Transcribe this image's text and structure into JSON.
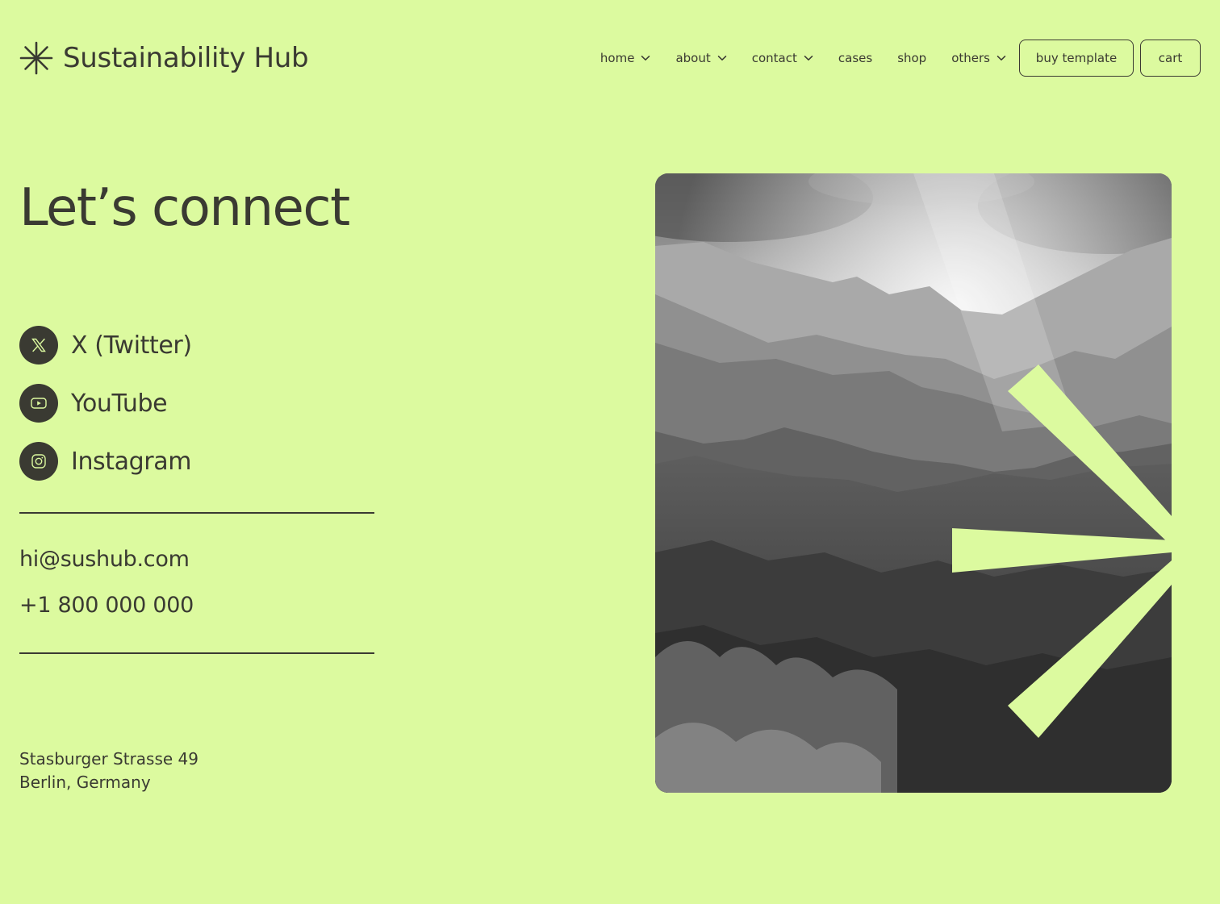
{
  "header": {
    "brand_name": "Sustainability Hub",
    "brand_icon": "asterisk-logo-icon",
    "nav": [
      {
        "label": "home",
        "has_dropdown": true
      },
      {
        "label": "about",
        "has_dropdown": true
      },
      {
        "label": "contact",
        "has_dropdown": true
      },
      {
        "label": "cases",
        "has_dropdown": false
      },
      {
        "label": "shop",
        "has_dropdown": false
      },
      {
        "label": "others",
        "has_dropdown": true
      }
    ],
    "buy_label": "buy template",
    "cart_label": "cart"
  },
  "main": {
    "heading": "Let’s connect",
    "socials": [
      {
        "label": "X (Twitter)",
        "icon": "x-twitter-icon"
      },
      {
        "label": "YouTube",
        "icon": "youtube-icon"
      },
      {
        "label": "Instagram",
        "icon": "instagram-icon"
      }
    ],
    "email": "hi@sushub.com",
    "phone": "+1 800 000 000",
    "address": {
      "line1": "Stasburger Strasse 49",
      "line2": "Berlin, Germany"
    }
  },
  "colors": {
    "background": "#dcfa9f",
    "text": "#3a3a32",
    "accent": "#dcfa9f"
  }
}
